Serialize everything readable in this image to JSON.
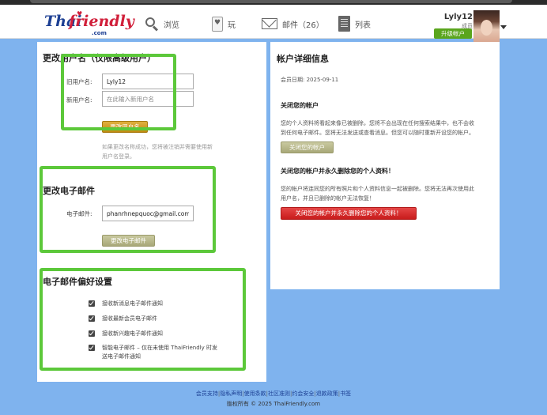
{
  "header": {
    "logo": {
      "thai": "Thai",
      "friendly": "friendly",
      "com": ".com"
    },
    "nav": {
      "browse": "浏览",
      "play": "玩",
      "mail": "邮件（26）",
      "list": "列表"
    },
    "user": {
      "name": "Lyly12",
      "role": "成员",
      "upgrade_label": "升级帐户"
    }
  },
  "change_username": {
    "title": "更改用户名（仅限高级用户）",
    "old_label": "旧用户名:",
    "old_value": "Lyly12",
    "new_label": "新用户名:",
    "new_placeholder": "在此输入新用户名",
    "button": "更改用户名",
    "hint_line1": "如果更改名称成功，您将被注销并需要使用新",
    "hint_line2": "用户名登录。"
  },
  "change_email": {
    "title": "更改电子邮件",
    "label": "电子邮件:",
    "value": "phanrhnepquoc@gmail.com",
    "button": "更改电子邮件"
  },
  "email_prefs": {
    "title": "电子邮件偏好设置",
    "items": [
      {
        "label": "接收新消息电子邮件通知",
        "checked": true
      },
      {
        "label": "接收最新会员电子邮件",
        "checked": true
      },
      {
        "label": "接收新兴趣电子邮件通知",
        "checked": true
      },
      {
        "label_line1": "智能电子邮件 – 仅在未使用 ThaiFriendly 时发",
        "label_line2": "送电子邮件通知",
        "checked": true
      }
    ]
  },
  "account_details": {
    "title": "帐户详细信息",
    "member_since": "会员日期: 2025-09-11",
    "close_title": "关闭您的帐户",
    "close_text_line1": "您的个人资料将看起来像已被删除，您将不会出现在任何搜索结果中，也不会收",
    "close_text_line2": "到任何电子邮件。您将无法发送或查看消息。但您可以随时重新开设您的帐户。",
    "close_button": "关闭您的帐户",
    "delete_title": "关闭您的帐户并永久删除您的个人资料！",
    "delete_text_line1": "您的帐户将连同您的所有照片和个人资料信息一起被删除。您将无法再次使用此",
    "delete_text_line2": "用户名，并且已删除的帐户无法恢复！",
    "delete_button": "关闭您的帐户并永久删除您的个人资料！"
  },
  "footer": {
    "links": [
      "会员支持",
      "隐私声明",
      "使用条款",
      "社区准则",
      "约会安全",
      "退款政策",
      "书签"
    ],
    "copyright": "版权所有 © 2025 ThaiFriendly.com"
  },
  "colors": {
    "background": "#7fb3ee",
    "highlight": "#5cc83a",
    "upgrade": "#5aa51d",
    "danger": "#c81c1c",
    "brand_blue": "#1c3f93",
    "brand_red": "#d11f3a"
  }
}
